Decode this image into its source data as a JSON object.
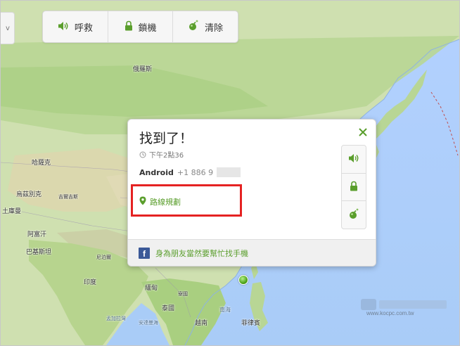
{
  "toolbar": {
    "buttons": [
      {
        "label": "呼救",
        "icon": "speaker-icon"
      },
      {
        "label": "鎖機",
        "icon": "lock-icon"
      },
      {
        "label": "清除",
        "icon": "bomb-icon"
      }
    ],
    "left_control_glyph": "v"
  },
  "map": {
    "labels": [
      "俄羅斯",
      "哈薩克",
      "烏茲別克",
      "吉爾吉斯",
      "土庫曼",
      "阿富汗",
      "巴基斯坦",
      "尼泊爾",
      "印度",
      "緬甸",
      "泰國",
      "越南",
      "菲律賓",
      "南海",
      "孟加拉灣",
      "安達曼海",
      "寮國"
    ],
    "accent_color": "#5a9e2c"
  },
  "popup": {
    "title": "找到了！",
    "time": "下午2點36",
    "device_name": "Android",
    "device_phone": "+1 886 9",
    "route_link": "路線規劃",
    "facebook_text": "身為朋友當然要幫忙找手機"
  },
  "watermark": {
    "url": "www.kocpc.com.tw"
  }
}
